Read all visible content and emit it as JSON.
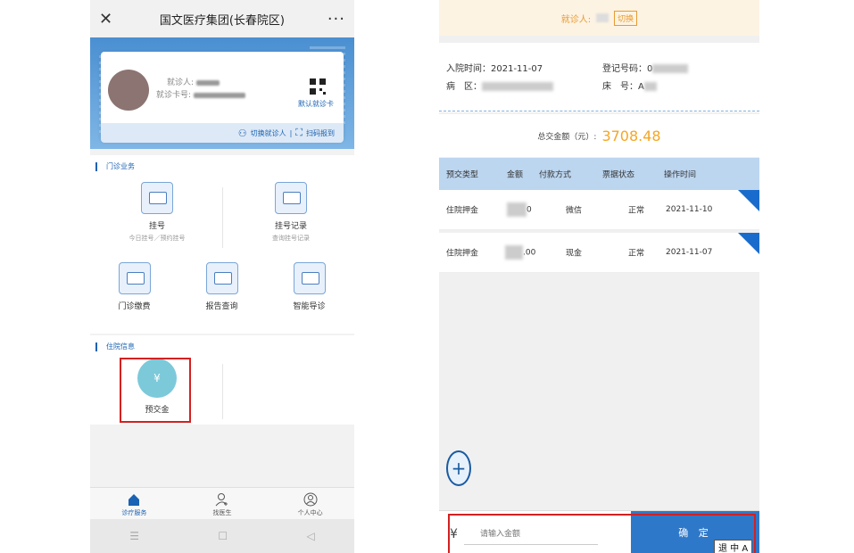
{
  "left": {
    "title": "国文医疗集团(长春院区)",
    "close_glyph": "✕",
    "more_glyph": "···",
    "patient_label": "就诊人:",
    "card_label": "就诊卡号:",
    "default_card": "默认就诊卡",
    "switch_patient": "切换就诊人",
    "scan_report": "扫码报到",
    "outpatient_section": "门诊业务",
    "outpatient_items": [
      {
        "label": "挂号",
        "sub": "今日挂号／预约挂号"
      },
      {
        "label": "挂号记录",
        "sub": "查询挂号记录"
      }
    ],
    "outpatient_row2": [
      {
        "label": "门诊缴费"
      },
      {
        "label": "报告查询"
      },
      {
        "label": "智能导诊"
      }
    ],
    "inpatient_section": "住院信息",
    "deposit_label": "预交金",
    "deposit_glyph": "¥",
    "tabs": [
      {
        "label": "诊疗服务",
        "icon": "home-icon"
      },
      {
        "label": "找医生",
        "icon": "doctor-icon"
      },
      {
        "label": "个人中心",
        "icon": "user-icon"
      }
    ],
    "nav_glyphs": [
      "☰",
      "☐",
      "◁"
    ]
  },
  "right": {
    "patient_label": "就诊人:",
    "switch_label": "切换",
    "admit_label": "入院时间：2021-11-07",
    "register_label": "登记号码：0",
    "ward_label": "病　区：",
    "bed_label": "床　号：A",
    "total_label": "总交金额（元）:",
    "total_amount": "3708.48",
    "headers": [
      "预交类型",
      "金额",
      "付款方式",
      "票据状态",
      "操作时间"
    ],
    "rows": [
      {
        "type": "住院押金",
        "amount": "0",
        "pay": "微信",
        "status": "正常",
        "time": "2021-11-10"
      },
      {
        "type": "住院押金",
        "amount": ".00",
        "pay": "现金",
        "status": "正常",
        "time": "2021-11-07"
      }
    ],
    "plus_glyph": "+",
    "yen_glyph": "¥",
    "amount_placeholder": "请输入金额",
    "confirm_label": "确 定",
    "tooltip": "退 中 A"
  }
}
